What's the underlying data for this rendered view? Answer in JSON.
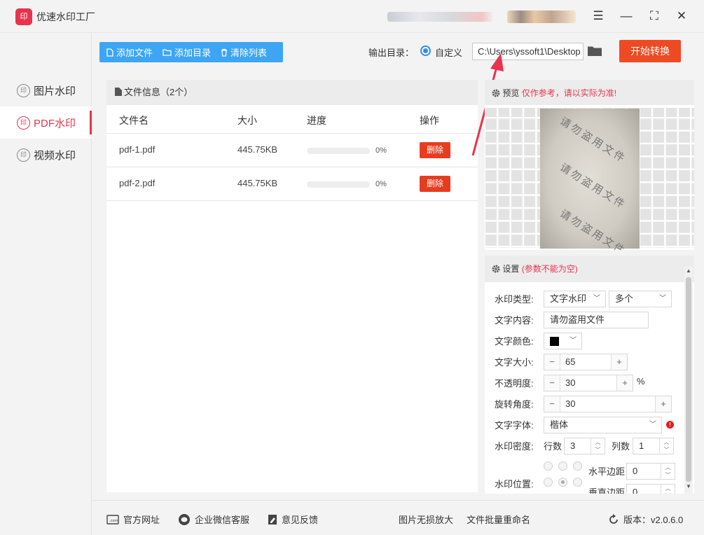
{
  "app": {
    "title": "优速水印工厂",
    "logo_text": "印"
  },
  "window": {
    "menu_icon": "☰",
    "minimize": "—",
    "maximize": "⛶",
    "close": "✕"
  },
  "sidebar": {
    "items": [
      {
        "label": "图片水印",
        "icon": "印",
        "active": false
      },
      {
        "label": "PDF水印",
        "icon": "印",
        "active": true
      },
      {
        "label": "视频水印",
        "icon": "印",
        "active": false
      }
    ]
  },
  "toolbar": {
    "add_file": "添加文件",
    "add_dir": "添加目录",
    "clear_list": "清除列表"
  },
  "output": {
    "label": "输出目录：",
    "radio_label": "自定义",
    "path": "C:\\Users\\yssoft1\\Desktop",
    "start_button": "开始转换"
  },
  "files": {
    "header": "文件信息（2个）",
    "columns": [
      "文件名",
      "大小",
      "进度",
      "操作"
    ],
    "rows": [
      {
        "name": "pdf-1.pdf",
        "size": "445.75KB",
        "progress": "0%",
        "action": "删除"
      },
      {
        "name": "pdf-2.pdf",
        "size": "445.75KB",
        "progress": "0%",
        "action": "删除"
      }
    ]
  },
  "preview": {
    "title": "预览",
    "note": "仅作参考，请以实际为准!",
    "watermark": "请勿盗用文件"
  },
  "settings": {
    "title": "设置",
    "note": "(参数不能为空)",
    "type_label": "水印类型:",
    "type_value": "文字水印",
    "multi_value": "多个",
    "content_label": "文字内容:",
    "content_value": "请勿盗用文件",
    "color_label": "文字颜色:",
    "color_value": "#000000",
    "size_label": "文字大小:",
    "size_value": "65",
    "opacity_label": "不透明度:",
    "opacity_value": "30",
    "opacity_unit": "%",
    "rotate_label": "旋转角度:",
    "rotate_value": "30",
    "font_label": "文字字体:",
    "font_value": "楷体",
    "density_label": "水印密度:",
    "rows_label": "行数",
    "rows_value": "3",
    "cols_label": "列数",
    "cols_value": "1",
    "position_label": "水印位置:",
    "hmargin_label": "水平边距",
    "hmargin_value": "0",
    "vmargin_label": "垂直边距",
    "vmargin_value": "0"
  },
  "footer": {
    "website": "官方网址",
    "wechat": "企业微信客服",
    "feedback": "意见反馈",
    "enlarge": "图片无损放大",
    "rename": "文件批量重命名",
    "version": "版本：v2.0.6.0"
  },
  "colors": {
    "accent": "#e8334f",
    "toolbar_blue": "#3da5f4",
    "start_orange": "#ee4a23",
    "delete_red": "#e73c1f"
  }
}
